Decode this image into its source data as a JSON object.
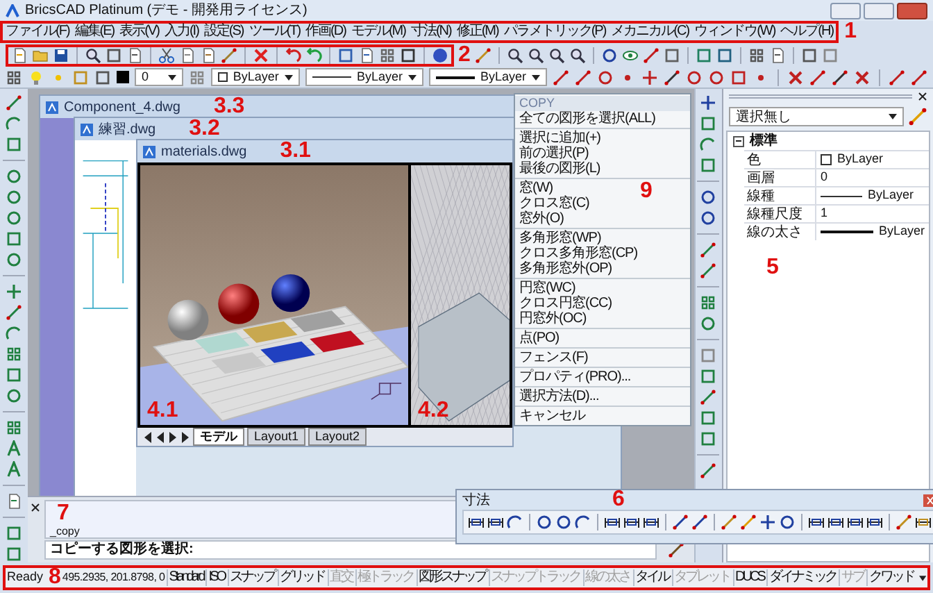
{
  "window": {
    "title": "BricsCAD Platinum (デモ - 開発用ライセンス)"
  },
  "menubar": {
    "callout": "1",
    "items": [
      "ファイル(F)",
      "編集(E)",
      "表示(V)",
      "入力(I)",
      "設定(S)",
      "ツール(T)",
      "作画(D)",
      "モデル(M)",
      "寸法(N)",
      "修正(M)",
      "パラメトリック(P)",
      "メカニカル(C)",
      "ウィンドウ(W)",
      "ヘルプ(H)"
    ]
  },
  "toolbar": {
    "callout": "2"
  },
  "layer_toolbar": {
    "layer": "0",
    "color_setting": "ByLayer",
    "linetype": "ByLayer",
    "lineweight": "ByLayer"
  },
  "documents": [
    {
      "title": "Component_4.dwg",
      "callout": "3.3"
    },
    {
      "title": "練習.dwg",
      "callout": "3.2"
    },
    {
      "title": "materials.dwg",
      "callout": "3.1"
    }
  ],
  "viewports": [
    {
      "callout": "4.1"
    },
    {
      "callout": "4.2"
    }
  ],
  "layout_tabs": [
    {
      "label": "モデル",
      "selected": true
    },
    {
      "label": "Layout1",
      "selected": false
    },
    {
      "label": "Layout2",
      "selected": false
    }
  ],
  "context_menu": {
    "title": "COPY",
    "callout": "9",
    "groups": [
      [
        "全ての図形を選択(ALL)"
      ],
      [
        "選択に追加(+)",
        "前の選択(P)",
        "最後の図形(L)"
      ],
      [
        "窓(W)",
        "クロス窓(C)",
        "窓外(O)"
      ],
      [
        "多角形窓(WP)",
        "クロス多角形窓(CP)",
        "多角形窓外(OP)"
      ],
      [
        "円窓(WC)",
        "クロス円窓(CC)",
        "円窓外(OC)"
      ],
      [
        "点(PO)"
      ],
      [
        "フェンス(F)"
      ],
      [
        "プロパティ(PRO)..."
      ],
      [
        "選択方法(D)..."
      ],
      [
        "キャンセル"
      ]
    ]
  },
  "properties": {
    "callout": "5",
    "selection": "選択無し",
    "section": "標準",
    "expanded": true,
    "rows": [
      {
        "label": "色",
        "value": "ByLayer",
        "kind": "color"
      },
      {
        "label": "画層",
        "value": "0",
        "kind": "text"
      },
      {
        "label": "線種",
        "value": "ByLayer",
        "kind": "line"
      },
      {
        "label": "線種尺度",
        "value": "1",
        "kind": "text"
      },
      {
        "label": "線の太さ",
        "value": "ByLayer",
        "kind": "thick"
      }
    ]
  },
  "command_line": {
    "callout": "7",
    "history": [
      "_copy"
    ],
    "prompt": "コピーする図形を選択:"
  },
  "dimension_toolbar": {
    "title": "寸法",
    "callout": "6"
  },
  "status_bar": {
    "callout": "8",
    "ready": "Ready",
    "coords": "495.2935, 201.8798, 0",
    "items": [
      {
        "label": "Standard",
        "on": true
      },
      {
        "label": "ISO",
        "on": true
      },
      {
        "label": "スナップ",
        "on": true
      },
      {
        "label": "グリッド",
        "on": true
      },
      {
        "label": "直交",
        "on": false
      },
      {
        "label": "極トラック",
        "on": false
      },
      {
        "label": "図形スナップ",
        "on": true
      },
      {
        "label": "スナップトラック",
        "on": false
      },
      {
        "label": "線の太さ",
        "on": false
      },
      {
        "label": "タイル",
        "on": true
      },
      {
        "label": "タブレット",
        "on": false
      },
      {
        "label": "DUCS",
        "on": true
      },
      {
        "label": "ダイナミック",
        "on": true
      },
      {
        "label": "サブ",
        "on": false
      },
      {
        "label": "クワッド",
        "on": true
      }
    ]
  }
}
